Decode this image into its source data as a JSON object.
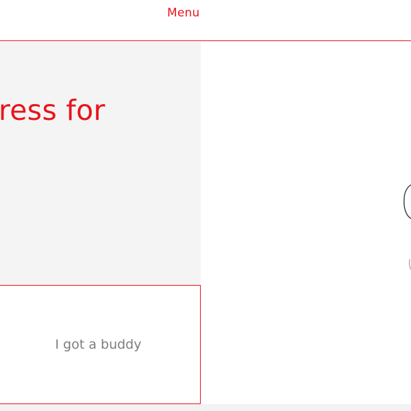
{
  "nav": {
    "menu_label": "Menu"
  },
  "hero": {
    "headline": "ress for"
  },
  "options": [
    {
      "label": "I got a buddy"
    }
  ],
  "colors": {
    "accent": "#e8141c",
    "panel_bg": "#f4f4f4",
    "muted_text": "#7d7d7d",
    "sketch_stroke": "#3a3a3a"
  },
  "illustration": {
    "icon": "line-drawing-illustration"
  }
}
